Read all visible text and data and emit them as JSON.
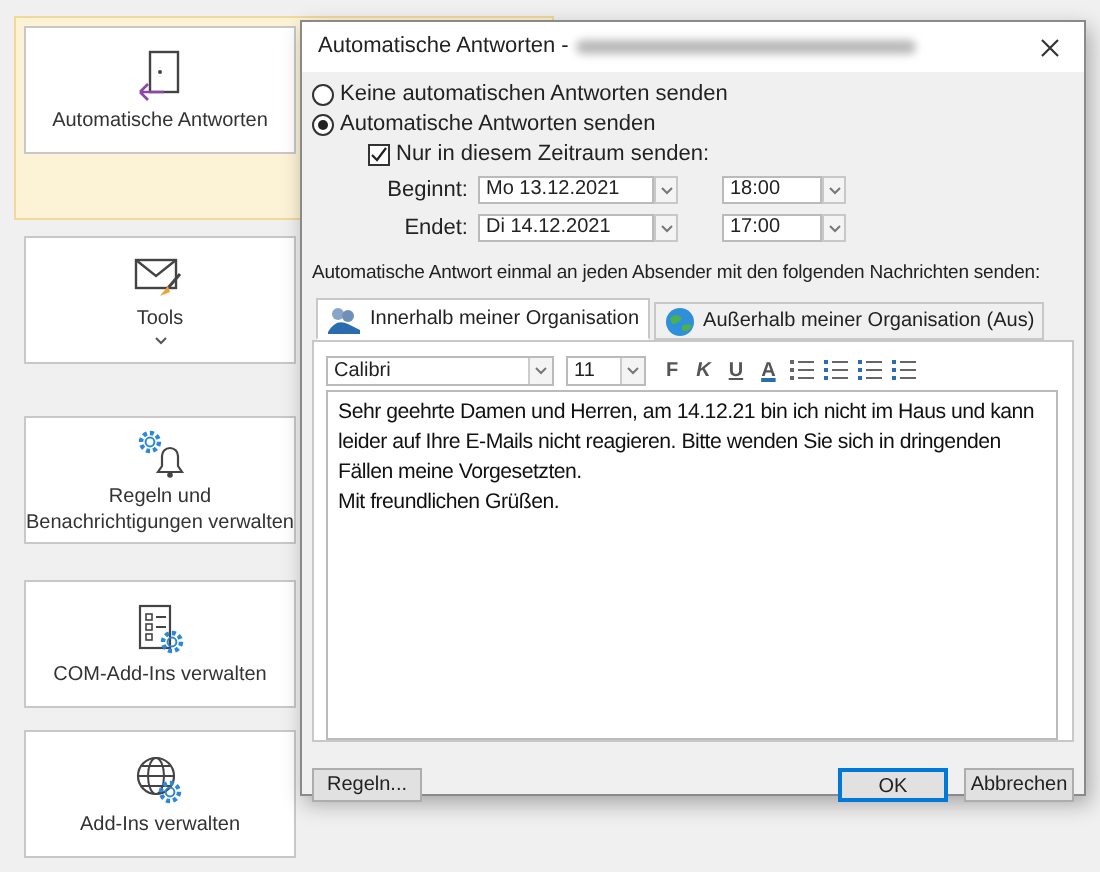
{
  "sidebar": {
    "items": [
      {
        "label": "Automatische Antworten",
        "selected": true
      },
      {
        "label": "Tools",
        "selected": false,
        "has_menu": true
      },
      {
        "label": "Regeln und Benachrichtigungen verwalten",
        "selected": false
      },
      {
        "label": "COM-Add-Ins verwalten",
        "selected": false
      },
      {
        "label": "Add-Ins verwalten",
        "selected": false
      }
    ]
  },
  "dialog": {
    "title": "Automatische Antworten -",
    "modes": [
      {
        "label": "Keine automatischen Antworten senden",
        "selected": false
      },
      {
        "label": "Automatische Antworten senden",
        "selected": true
      }
    ],
    "period": {
      "label": "Nur in diesem Zeitraum senden:",
      "checked": true
    },
    "schedule": [
      {
        "label": "Beginnt:",
        "date": "Mo 13.12.2021",
        "time": "18:00"
      },
      {
        "label": "Endet:",
        "date": "Di 14.12.2021",
        "time": "17:00"
      }
    ],
    "instruction": "Automatische Antwort einmal an jeden Absender mit den folgenden Nachrichten senden:",
    "tabs": [
      {
        "label": "Innerhalb meiner Organisation",
        "selected": true
      },
      {
        "label": "Außerhalb meiner Organisation (Aus)",
        "selected": false
      }
    ],
    "toolbar": {
      "font": "Calibri",
      "size": "11",
      "format_buttons": [
        "F",
        "K",
        "U",
        "A"
      ]
    },
    "message": [
      "Sehr geehrte Damen und Herren, am 14.12.21 bin ich nicht im Haus und kann leider auf Ihre E-Mails nicht reagieren. Bitte wenden Sie sich in dringenden Fällen meine Vorgesetzten.",
      "Mit freundlichen Grüßen."
    ],
    "buttons": [
      {
        "label": "Regeln...",
        "default": false
      },
      {
        "label": "OK",
        "default": true
      },
      {
        "label": "Abbrechen",
        "default": false
      }
    ]
  }
}
